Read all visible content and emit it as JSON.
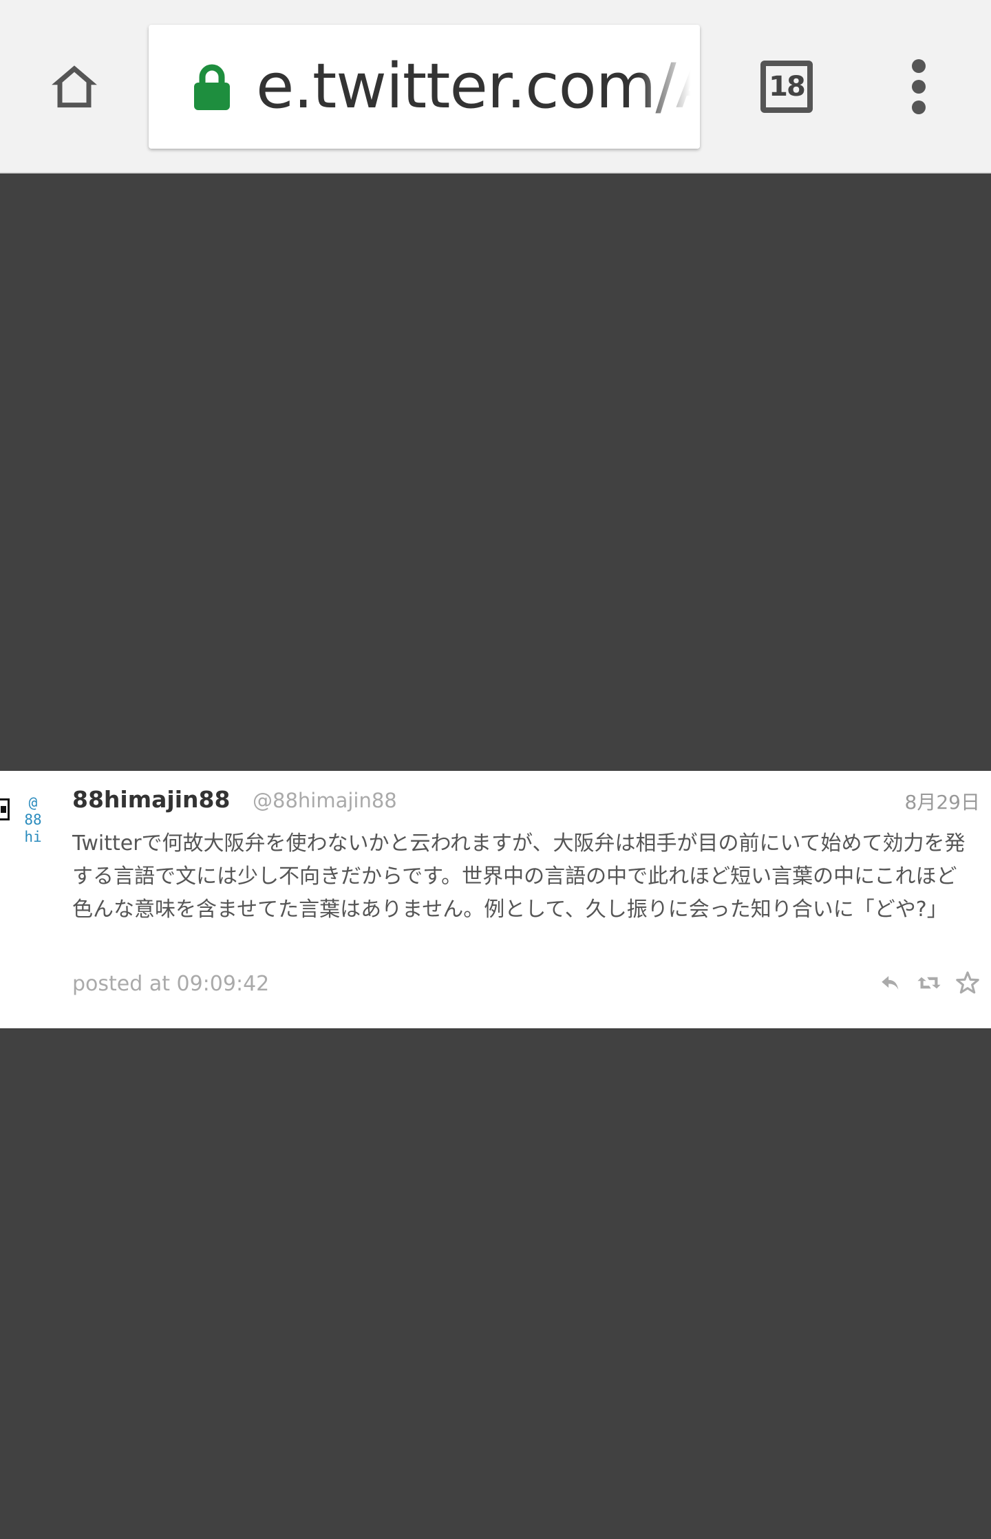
{
  "browser": {
    "url": "e.twitter.com/A",
    "tab_count": "18",
    "icons": {
      "home": "home-icon",
      "lock": "lock-icon",
      "menu": "more-vertical-icon"
    },
    "lock_color": "#1e8e3e"
  },
  "tweet": {
    "avatar_lines": [
      "@",
      "88",
      "hi"
    ],
    "name": "88himajin88",
    "handle": "@88himajin88",
    "date": "8月29日",
    "text": "Twitterで何故大阪弁を使わないかと云われますが、大阪弁は相手が目の前にいて始めて効力を発する言語で文には少し不向きだからです。世界中の言語の中で此れほど短い言葉の中にこれほど色んな意味を含ませてた言葉はありません。例として、久し振りに会った知り合いに「どや?」",
    "posted": "posted at 09:09:42",
    "actions": [
      "reply-icon",
      "retweet-icon",
      "favorite-icon"
    ]
  }
}
